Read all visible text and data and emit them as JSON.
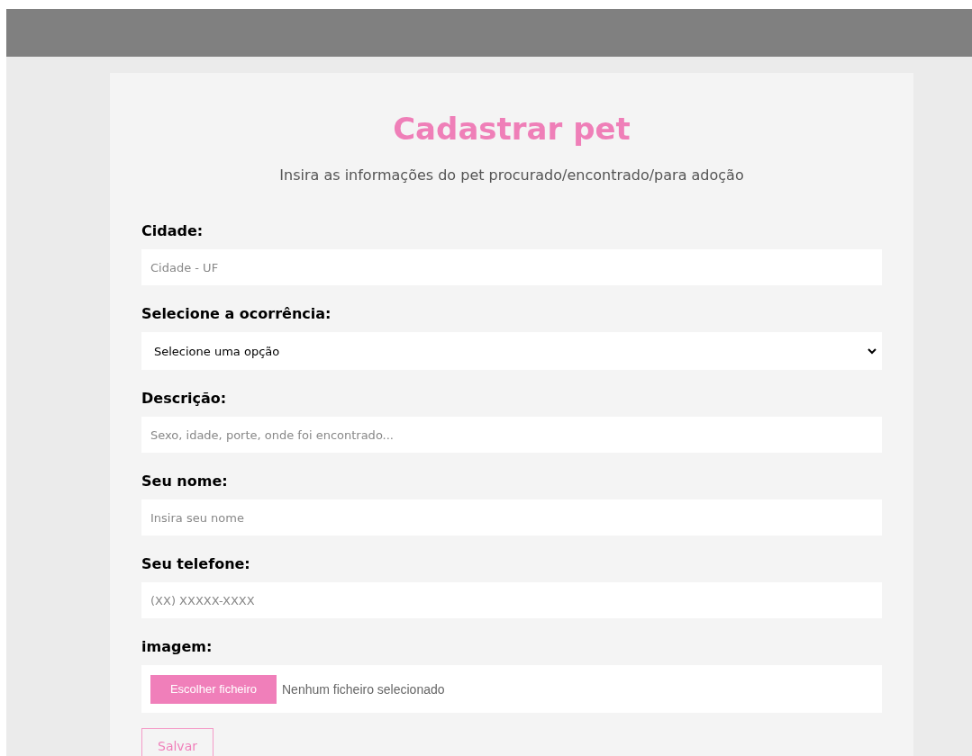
{
  "form": {
    "title": "Cadastrar pet",
    "subtitle": "Insira as informações do pet procurado/encontrado/para adoção",
    "fields": [
      {
        "kind": "input",
        "label": "Cidade:",
        "placeholder": "Cidade - UF"
      },
      {
        "kind": "select",
        "label": "Selecione a ocorrência:",
        "value": "Selecione uma opção"
      },
      {
        "kind": "input",
        "label": "Descrição:",
        "placeholder": "Sexo, idade, porte, onde foi encontrado..."
      },
      {
        "kind": "input",
        "label": "Seu nome:",
        "placeholder": "Insira seu nome"
      },
      {
        "kind": "input",
        "label": "Seu telefone:",
        "placeholder": "(XX) XXXXX-XXXX"
      },
      {
        "kind": "file",
        "label": "imagem:",
        "button": "Escolher ficheiro",
        "status": "Nenhum ficheiro selecionado"
      }
    ],
    "submit": "Salvar"
  }
}
